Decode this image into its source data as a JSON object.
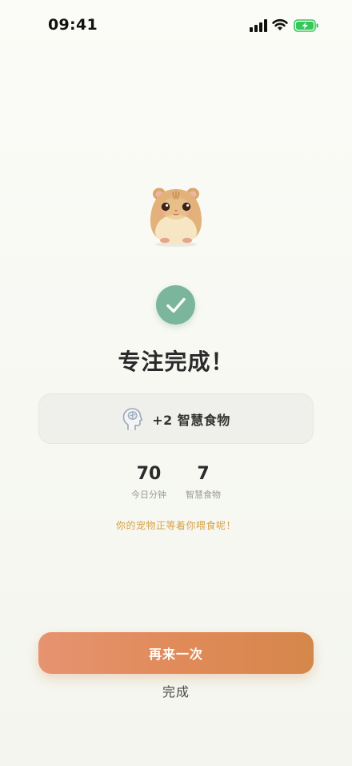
{
  "status_bar": {
    "time": "09:41"
  },
  "completion": {
    "title": "专注完成！",
    "reward_text": "+2 智慧食物",
    "hint": "你的宠物正等着你喂食呢！"
  },
  "stats": [
    {
      "value": "70",
      "label": "今日分钟"
    },
    {
      "value": "7",
      "label": "智慧食物"
    }
  ],
  "actions": {
    "again_label": "再来一次",
    "done_label": "完成"
  },
  "icons": {
    "pet": "hamster-icon",
    "check": "check-icon",
    "reward": "brain-head-icon"
  },
  "colors": {
    "accent_green": "#7bb59b",
    "button_gradient_start": "#e69370",
    "button_gradient_end": "#d5874a",
    "hint_color": "#d6a24a"
  }
}
